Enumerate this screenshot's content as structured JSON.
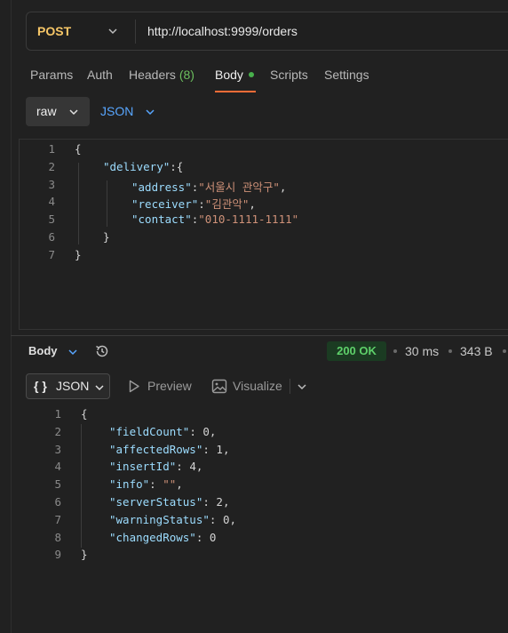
{
  "request": {
    "method": "POST",
    "url": "http://localhost:9999/orders"
  },
  "tabs": [
    {
      "label": "Params"
    },
    {
      "label": "Auth"
    },
    {
      "label": "Headers",
      "count": "(8)"
    },
    {
      "label": "Body",
      "active": true
    },
    {
      "label": "Scripts"
    },
    {
      "label": "Settings"
    }
  ],
  "body_mode": {
    "raw_label": "raw",
    "format_label": "JSON"
  },
  "request_body": {
    "line_numbers": [
      "1",
      "2",
      "3",
      "4",
      "5",
      "6",
      "7"
    ],
    "lines": [
      [
        {
          "t": "p",
          "v": "{"
        }
      ],
      [
        {
          "t": "k",
          "v": "\"delivery\""
        },
        {
          "t": "p",
          "v": ":{"
        }
      ],
      [
        {
          "t": "k",
          "v": "\"address\""
        },
        {
          "t": "p",
          "v": ":"
        },
        {
          "t": "s",
          "v": "\"서울시 관악구\""
        },
        {
          "t": "p",
          "v": ","
        }
      ],
      [
        {
          "t": "k",
          "v": "\"receiver\""
        },
        {
          "t": "p",
          "v": ":"
        },
        {
          "t": "s",
          "v": "\"김관악\""
        },
        {
          "t": "p",
          "v": ","
        }
      ],
      [
        {
          "t": "k",
          "v": "\"contact\""
        },
        {
          "t": "p",
          "v": ":"
        },
        {
          "t": "s",
          "v": "\"010-1111-1111\""
        }
      ],
      [
        {
          "t": "p",
          "v": "}"
        }
      ],
      [
        {
          "t": "p",
          "v": "}"
        }
      ]
    ]
  },
  "response": {
    "body_label": "Body",
    "status": "200 OK",
    "time": "30 ms",
    "size": "343 B",
    "format_label": "JSON",
    "format_brace": "{ }",
    "preview_label": "Preview",
    "visualize_label": "Visualize",
    "line_numbers": [
      "1",
      "2",
      "3",
      "4",
      "5",
      "6",
      "7",
      "8",
      "9"
    ],
    "lines": [
      [
        {
          "t": "p",
          "v": "{"
        }
      ],
      [
        {
          "t": "k",
          "v": "\"fieldCount\""
        },
        {
          "t": "p",
          "v": ": "
        },
        {
          "t": "n",
          "v": "0"
        },
        {
          "t": "p",
          "v": ","
        }
      ],
      [
        {
          "t": "k",
          "v": "\"affectedRows\""
        },
        {
          "t": "p",
          "v": ": "
        },
        {
          "t": "n",
          "v": "1"
        },
        {
          "t": "p",
          "v": ","
        }
      ],
      [
        {
          "t": "k",
          "v": "\"insertId\""
        },
        {
          "t": "p",
          "v": ": "
        },
        {
          "t": "n",
          "v": "4"
        },
        {
          "t": "p",
          "v": ","
        }
      ],
      [
        {
          "t": "k",
          "v": "\"info\""
        },
        {
          "t": "p",
          "v": ": "
        },
        {
          "t": "s",
          "v": "\"\""
        },
        {
          "t": "p",
          "v": ","
        }
      ],
      [
        {
          "t": "k",
          "v": "\"serverStatus\""
        },
        {
          "t": "p",
          "v": ": "
        },
        {
          "t": "n",
          "v": "2"
        },
        {
          "t": "p",
          "v": ","
        }
      ],
      [
        {
          "t": "k",
          "v": "\"warningStatus\""
        },
        {
          "t": "p",
          "v": ": "
        },
        {
          "t": "n",
          "v": "0"
        },
        {
          "t": "p",
          "v": ","
        }
      ],
      [
        {
          "t": "k",
          "v": "\"changedRows\""
        },
        {
          "t": "p",
          "v": ": "
        },
        {
          "t": "n",
          "v": "0"
        }
      ],
      [
        {
          "t": "p",
          "v": "}"
        }
      ]
    ]
  },
  "colors": {
    "method": "#f6c667",
    "accent": "#ff6c37",
    "status_ok": "#5ed06a",
    "link": "#58a6ff"
  }
}
